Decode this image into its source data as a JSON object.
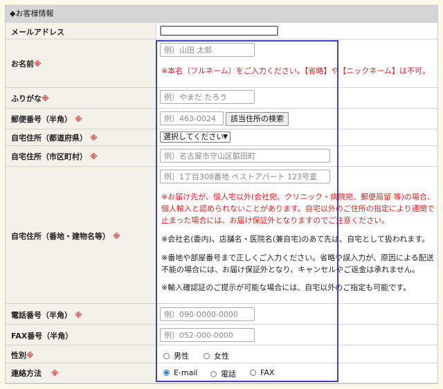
{
  "section": {
    "title": "◆お客様情報"
  },
  "required_mark": "※",
  "fields": {
    "email": {
      "label": "メールアドレス"
    },
    "name": {
      "label": "お名前",
      "placeholder": "例）山田 太郎",
      "note": "※本名（フルネーム）をご入力ください。【省略】や【ニックネーム】は不可。"
    },
    "furigana": {
      "label": "ふりがな",
      "placeholder": "例）やまだ たろう"
    },
    "postal": {
      "label": "郵便番号（半角）",
      "placeholder": "例）463-0024",
      "button": "該当住所の検索"
    },
    "prefecture": {
      "label": "自宅住所（都道府県）",
      "selected": "選択してください"
    },
    "city": {
      "label": "自宅住所（市区町村）",
      "placeholder": "例）名古屋市守山区脇田町"
    },
    "street": {
      "label": "自宅住所（番地・建物名等）",
      "placeholder": "例）1丁目308番地 ベストアパート 123号室",
      "notes_red": [
        "※お届け先が、個人宅以外(会社宛、クリニック・病院宛、郵便局留 等)の場合、",
        "個人輸入と認められないことがあります。自宅以外のご住所の指定により通関で",
        "止まった場合には、お届け保証外となりますのでご注意ください。"
      ],
      "note_company": "※会社名(委内)、店舗名・医院名(兼自宅)のあて先は、自宅として扱われます。",
      "notes_missing": [
        "※番地や部屋番号まで正しくご入力ください。省略や誤入力が、原因による配送",
        "不能の場合には、お届け保証外となり、キャンセルやご返金は承れません。"
      ],
      "note_import": "※輸入確認証のご提示が可能な場合には、自宅以外のご指定も可能です。"
    },
    "phone": {
      "label": "電話番号（半角）",
      "placeholder": "例）090-0000-0000"
    },
    "fax": {
      "label": "FAX番号（半角）",
      "placeholder": "例）052-000-0000"
    },
    "gender": {
      "label": "性別",
      "options": [
        "男性",
        "女性"
      ]
    },
    "contact": {
      "label": "連絡方法",
      "options": [
        "E-mail",
        "電話",
        "FAX"
      ],
      "selected": "E-mail"
    }
  },
  "colors": {
    "highlight_box": "#3c3fc4",
    "required": "#e33",
    "radio_selected": "#1a73e8"
  }
}
